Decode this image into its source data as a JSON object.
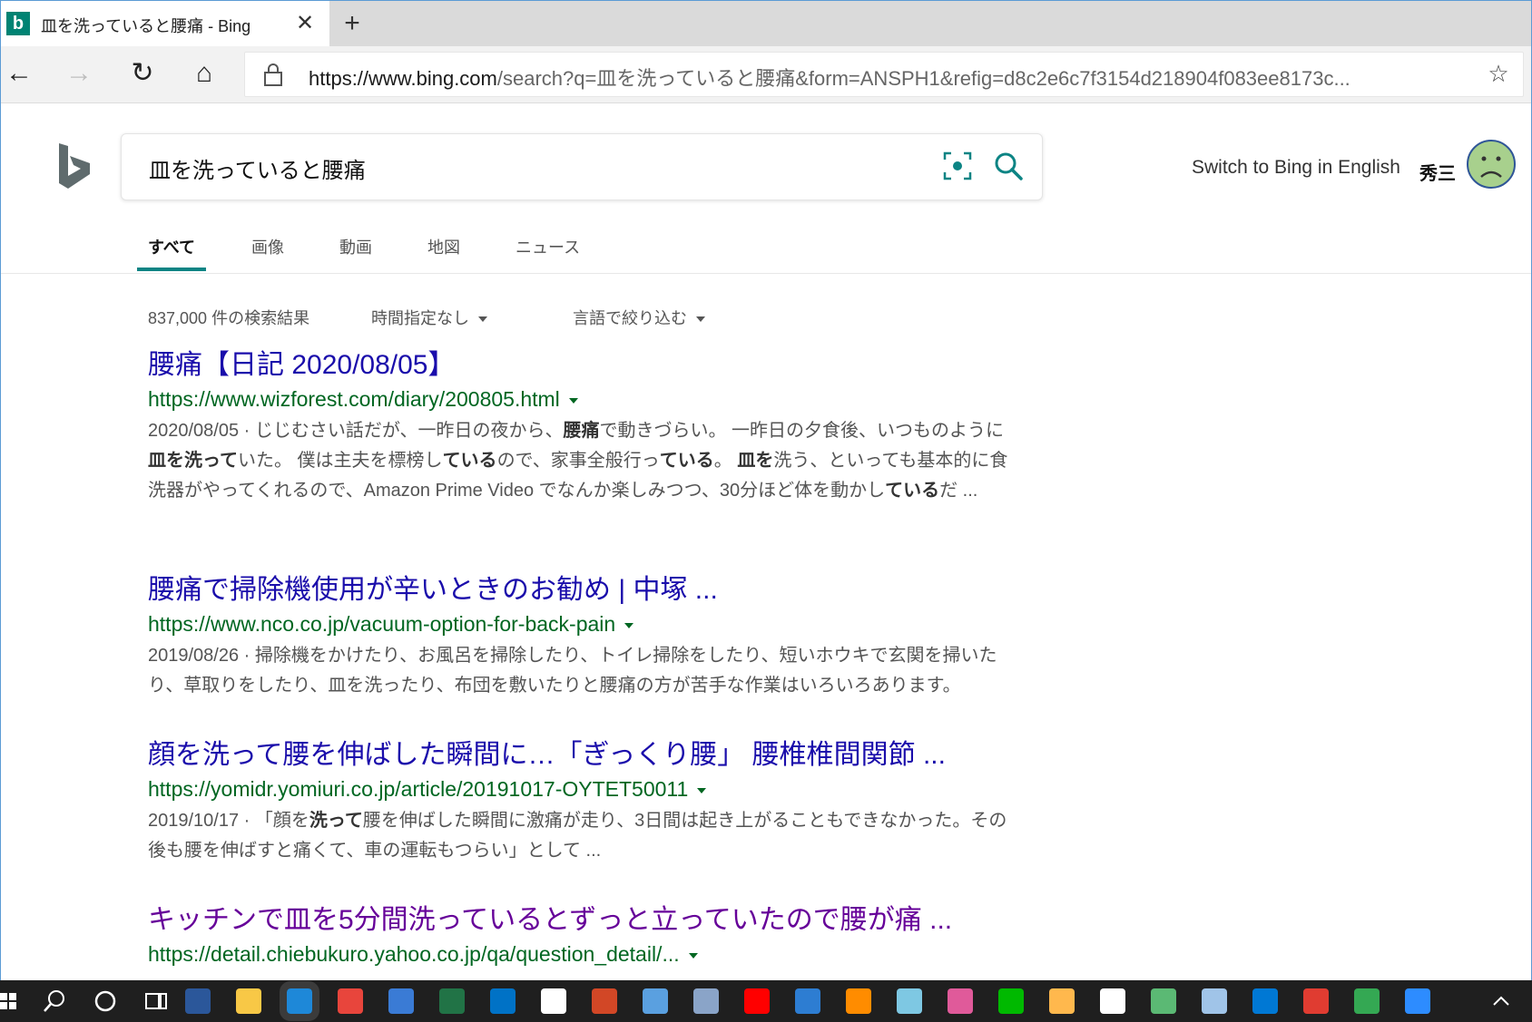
{
  "window": {
    "tab_title": "皿を洗っていると腰痛 - Bing",
    "favicon_letter": "b",
    "close_symbol": "✕",
    "newtab_symbol": "+"
  },
  "toolbar": {
    "back": "←",
    "forward": "→",
    "refresh": "↻",
    "home": "⌂",
    "url_host": "https://www.bing.com",
    "url_rest": "/search?q=皿を洗っていると腰痛&form=ANSPH1&refig=d8c2e6c7f3154d218904f083ee8173c...",
    "favorite": "☆"
  },
  "header": {
    "query": "皿を洗っていると腰痛",
    "switch_lang": "Switch to Bing in English",
    "username": "秀三"
  },
  "scopes": [
    "すべて",
    "画像",
    "動画",
    "地図",
    "ニュース"
  ],
  "meta": {
    "count": "837,000 件の検索結果",
    "time_filter": "時間指定なし",
    "lang_filter": "言語で絞り込む"
  },
  "results": [
    {
      "title": "腰痛【日記 2020/08/05】",
      "url": "https://www.wizforest.com/diary/200805.html",
      "snippet_html": "2020/08/05 · じじむさい話だが、一昨日の夜から、<b>腰痛</b>で動きづらい。 一昨日の夕食後、いつものように<b>皿を洗って</b>いた。 僕は主夫を標榜し<b>ている</b>ので、家事全般行っ<b>ている</b>。 <b>皿を</b>洗う、といっても基本的に食洗器がやってくれるので、Amazon Prime Video でなんか楽しみつつ、30分ほど体を動かし<b>ている</b>だ ..."
    },
    {
      "title": "腰痛で掃除機使用が辛いときのお勧め | 中塚 ...",
      "url": "https://www.nco.co.jp/vacuum-option-for-back-pain",
      "snippet_html": "2019/08/26 · 掃除機をかけたり、お風呂を掃除したり、トイレ掃除をしたり、短いホウキで玄関を掃いたり、草取りをしたり、皿を洗ったり、布団を敷いたりと腰痛の方が苦手な作業はいろいろあります。"
    },
    {
      "title": "顔を洗って腰を伸ばした瞬間に…「ぎっくり腰」 腰椎椎間関節 ...",
      "url": "https://yomidr.yomiuri.co.jp/article/20191017-OYTET50011",
      "snippet_html": "2019/10/17 · 「顔を<b>洗って</b>腰を伸ばした瞬間に激痛が走り、3日間は起き上がることもできなかった。その後も腰を伸ばすと痛くて、車の運転もつらい」として ..."
    },
    {
      "title": "キッチンで皿を5分間洗っているとずっと立っていたので腰が痛 ...",
      "url": "https://detail.chiebukuro.yahoo.co.jp/qa/question_detail/...",
      "snippet_html": ""
    }
  ],
  "taskbar_icons": [
    "windows-icon",
    "search-icon",
    "cortana-icon",
    "task-view-icon",
    "word-icon",
    "file-explorer-icon",
    "edge-icon",
    "chrome-icon",
    "people-icon",
    "excel-icon",
    "outlook-icon",
    "amazon-icon",
    "powerpoint-icon",
    "control-panel-icon",
    "network-icon",
    "youtube-icon",
    "photos-icon",
    "paint-icon",
    "paint3d-icon",
    "snip-icon",
    "line-icon",
    "game-icon",
    "google-icon",
    "maps-icon",
    "inbox-icon",
    "onedrive-icon",
    "pdf-png-icon",
    "play-store-icon",
    "zoom-icon",
    "chevron-up-icon"
  ],
  "colors": {
    "link": "#1a0dab",
    "visited": "#660099",
    "url_green": "#006621",
    "accent": "#0c8484"
  }
}
